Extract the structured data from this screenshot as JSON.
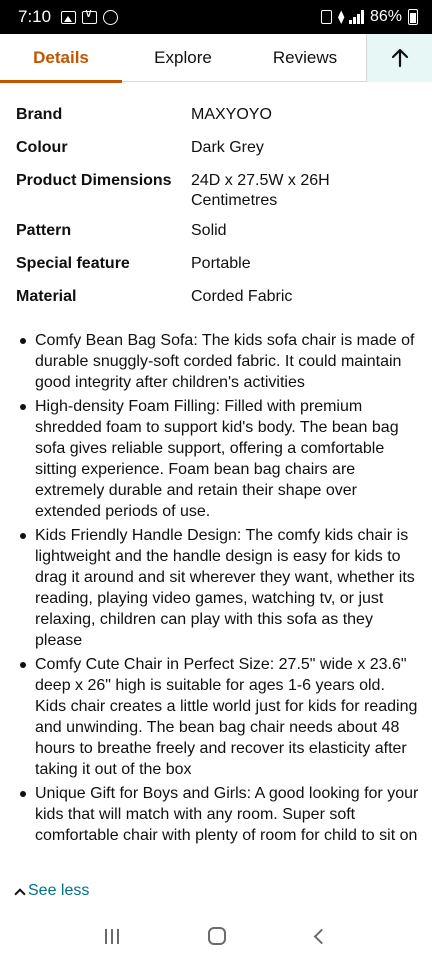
{
  "status_bar": {
    "time": "7:10",
    "battery": "86%"
  },
  "tabs": [
    {
      "label": "Details"
    },
    {
      "label": "Explore"
    },
    {
      "label": "Reviews"
    }
  ],
  "back_to_top_icon": "arrow-up-icon",
  "specs": [
    {
      "key": "Brand",
      "value": "MAXYOYO"
    },
    {
      "key": "Colour",
      "value": "Dark Grey"
    },
    {
      "key": "Product Dimensions",
      "value": "24D x 27.5W x 26H Centimetres"
    },
    {
      "key": "Pattern",
      "value": "Solid"
    },
    {
      "key": "Special feature",
      "value": "Portable"
    },
    {
      "key": "Material",
      "value": "Corded Fabric"
    }
  ],
  "bullets": [
    "Comfy Bean Bag Sofa: The kids sofa chair is made of durable snuggly-soft corded fabric. It could maintain good integrity after children's activities",
    "High-density Foam Filling: Filled with premium shredded foam to support kid's body. The bean bag sofa gives reliable support, offering a comfortable sitting experience. Foam bean bag chairs are extremely durable and retain their shape over extended periods of use.",
    "Kids Friendly Handle Design: The comfy kids chair is lightweight and the handle design is easy for kids to drag it around and sit wherever they want, whether its reading, playing video games, watching tv, or just relaxing, children can play with this sofa as they please",
    "Comfy Cute Chair in Perfect Size: 27.5\" wide x 23.6\" deep x 26\" high is suitable for ages 1-6 years old. Kids chair creates a little world just for kids for reading and unwinding. The bean bag chair needs about 48 hours to breathe freely and recover its elasticity after taking it out of the box",
    "Unique Gift for Boys and Girls: A good looking for your kids that will match with any room. Super soft comfortable chair with plenty of room for child to sit on"
  ],
  "see_less_label": "See less",
  "colors": {
    "accent": "#c45500",
    "link": "#007185",
    "tab_highlight": "#e6f7f6"
  }
}
